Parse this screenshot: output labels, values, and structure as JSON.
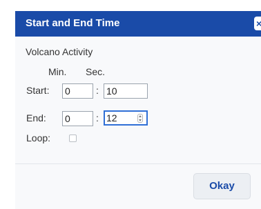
{
  "dialog": {
    "title": "Start and End Time",
    "close_label": "×",
    "activity_name": "Volcano Activity"
  },
  "columns": {
    "min": "Min.",
    "sec": "Sec."
  },
  "start": {
    "label": "Start:",
    "min": "0",
    "sec": "10"
  },
  "end": {
    "label": "End:",
    "min": "0",
    "sec": "12"
  },
  "separator": ":",
  "loop": {
    "label": "Loop:",
    "checked": false
  },
  "footer": {
    "okay_label": "Okay"
  },
  "icons": [
    "close-icon",
    "spinner-icon"
  ],
  "colors": {
    "title_bar": "#1a4ba8",
    "focus_ring": "#2f6fd6",
    "body_bg": "#f8f9fb"
  }
}
